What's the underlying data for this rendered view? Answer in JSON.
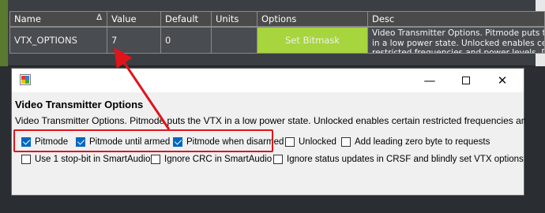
{
  "grid": {
    "columns": [
      "Name",
      "Value",
      "Default",
      "Units",
      "Options",
      "Desc"
    ],
    "row": {
      "name": "VTX_OPTIONS",
      "value": "7",
      "default": "0",
      "units": "",
      "options_button": "Set Bitmask",
      "desc": "Video Transmitter Options. Pitmode puts the VTX in a low power state. Unlocked enables certain restricted frequencies and power levels. Do not enable the Unlocked option unless you have appropriate permissions in your jurisdiction to transmit at high power levels."
    },
    "sort_icon": "triangle-sort-icon"
  },
  "dialog": {
    "title_icon": "app-window-icon",
    "minimize": "—",
    "close": "✕",
    "heading": "Video Transmitter Options",
    "description": "Video Transmitter Options. Pitmode puts the VTX in a low power state. Unlocked enables certain restricted frequencies and power levels.",
    "options": [
      {
        "label": "Pitmode",
        "checked": true
      },
      {
        "label": "Pitmode until armed",
        "checked": true
      },
      {
        "label": "Pitmode when disarmed",
        "checked": true
      },
      {
        "label": "Unlocked",
        "checked": false
      },
      {
        "label": "Add leading zero byte to requests",
        "checked": false
      },
      {
        "label": "Use 1 stop-bit in SmartAudio",
        "checked": false
      },
      {
        "label": "Ignore CRC in SmartAudio",
        "checked": false
      },
      {
        "label": "Ignore status updates in CRSF and blindly set VTX options",
        "checked": false
      }
    ]
  },
  "colors": {
    "accent_button": "#a6d53d",
    "highlight": "#e0141b",
    "checkbox_on": "#0067c0"
  }
}
